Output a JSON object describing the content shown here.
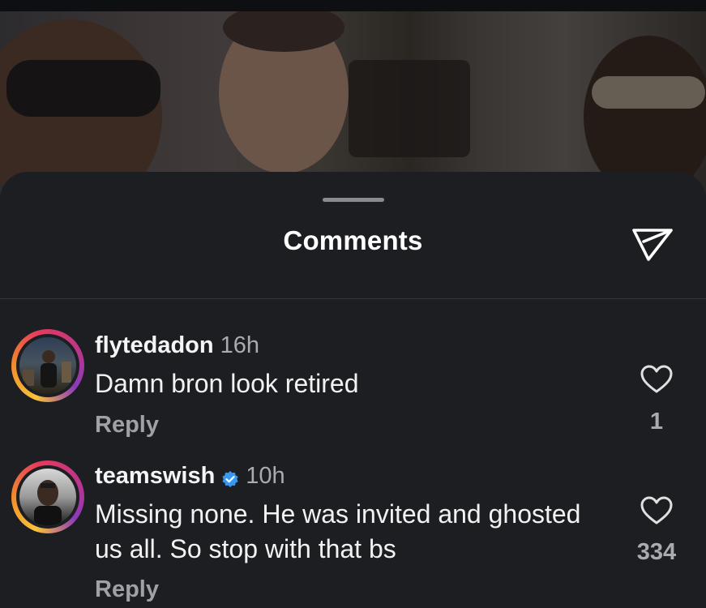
{
  "header": {
    "title": "Comments",
    "share_icon": "paper-plane-icon"
  },
  "comments": [
    {
      "username": "flytedadon",
      "time": "16h",
      "verified": false,
      "text": "Damn bron look retired",
      "reply_label": "Reply",
      "likes": "1"
    },
    {
      "username": "teamswish",
      "time": "10h",
      "verified": true,
      "text": "Missing none. He was invited and ghosted us all. So stop with that bs",
      "reply_label": "Reply",
      "likes": "334"
    }
  ],
  "colors": {
    "sheet_bg": "#1c1e22",
    "verified_blue": "#3897f0",
    "muted": "#a8abb0"
  }
}
